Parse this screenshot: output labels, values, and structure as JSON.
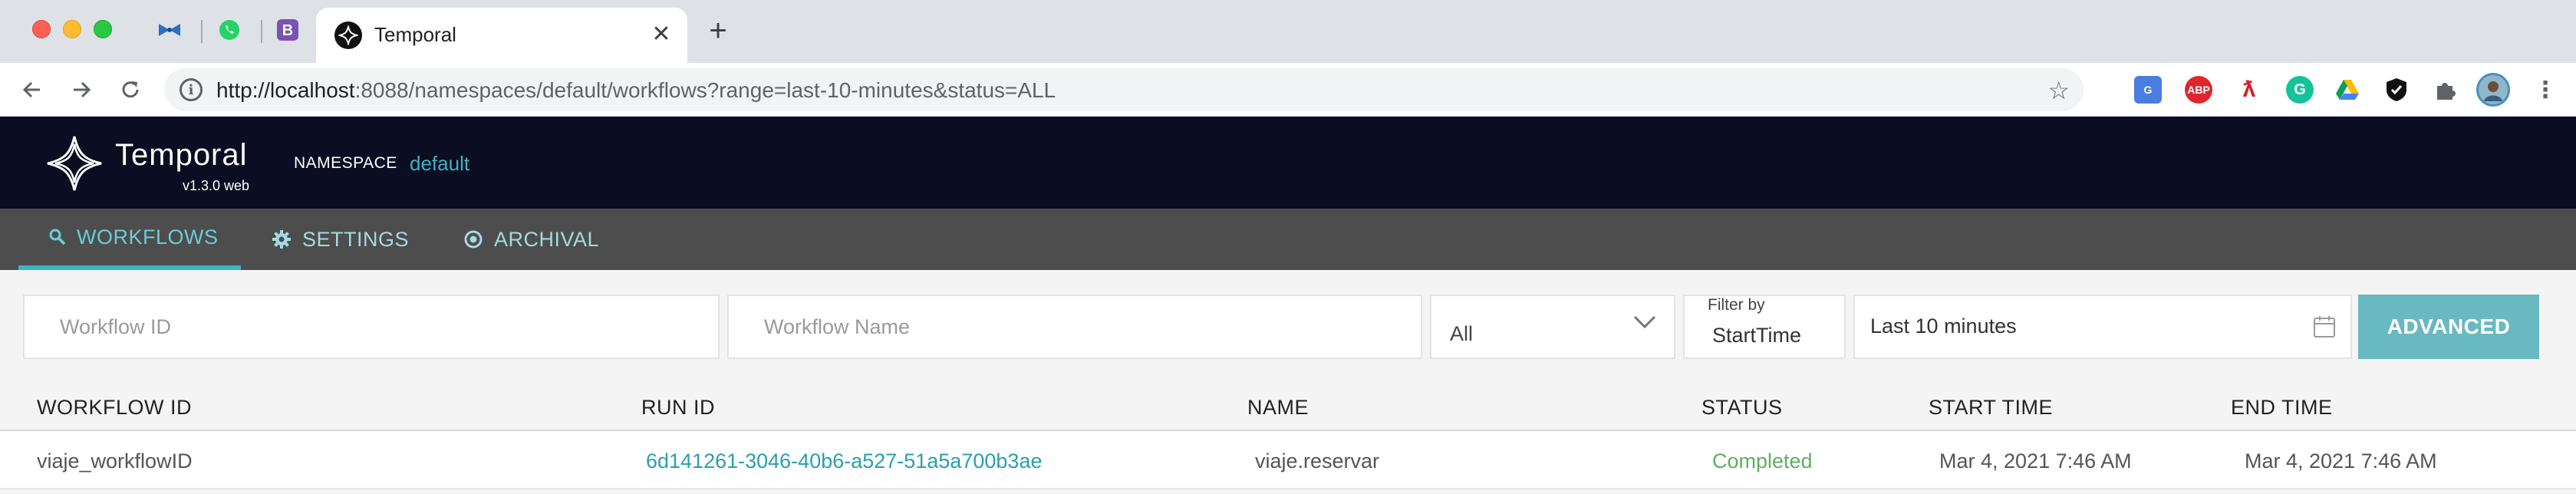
{
  "browser": {
    "tab_title": "Temporal",
    "url_host": "http://localhost",
    "url_rest": ":8088/namespaces/default/workflows?range=last-10-minutes&status=ALL",
    "extensions": [
      "google-translate-icon",
      "adblock-plus-icon",
      "acrobat-icon",
      "grammarly-icon",
      "google-drive-icon",
      "shield-extension-icon",
      "puzzle-extensions-icon",
      "profile-avatar"
    ]
  },
  "header": {
    "brand": "Temporal",
    "version": "v1.3.0 web",
    "namespace_label": "NAMESPACE",
    "namespace_value": "default",
    "accent": "#3bb5c2",
    "background": "#0b0e22"
  },
  "nav": {
    "tabs": [
      {
        "label": "WORKFLOWS",
        "icon": "search-icon",
        "active": true
      },
      {
        "label": "SETTINGS",
        "icon": "gear-icon",
        "active": false
      },
      {
        "label": "ARCHIVAL",
        "icon": "archive-icon",
        "active": false
      }
    ]
  },
  "filters": {
    "workflow_id_placeholder": "Workflow ID",
    "workflow_name_placeholder": "Workflow Name",
    "status_selected": "All",
    "filter_by_caption": "Filter by",
    "filter_by_value": "StartTime",
    "range_value": "Last 10 minutes",
    "advanced_label": "ADVANCED"
  },
  "table": {
    "columns": [
      "WORKFLOW ID",
      "RUN ID",
      "NAME",
      "STATUS",
      "START TIME",
      "END TIME"
    ],
    "rows": [
      {
        "workflow_id": "viaje_workflowID",
        "run_id": "6d141261-3046-40b6-a527-51a5a700b3ae",
        "name": "viaje.reservar",
        "status": "Completed",
        "start_time": "Mar 4, 2021 7:46 AM",
        "end_time": "Mar 4, 2021 7:46 AM"
      }
    ]
  }
}
